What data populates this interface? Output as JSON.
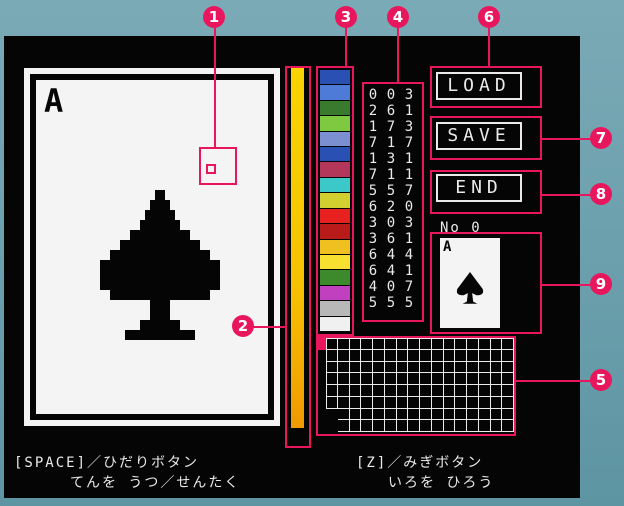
{
  "card": {
    "rank": "A",
    "suit_icon": "spade"
  },
  "buttons": {
    "load": "LOAD",
    "save": "SAVE",
    "end": "END"
  },
  "preview": {
    "label": "No 0",
    "rank": "A"
  },
  "hints": {
    "left_line1": "[SPACE]／ひだりボタン",
    "left_line2": "てんを うつ／せんたく",
    "right_line1": "[Z]／みぎボタン",
    "right_line2": "いろを ひろう"
  },
  "callouts": [
    "1",
    "2",
    "3",
    "4",
    "5",
    "6",
    "7",
    "8",
    "9"
  ],
  "palette": [
    "#2b50b4",
    "#4e7ad8",
    "#3a7a2e",
    "#7fc940",
    "#7c8fd0",
    "#2b50b4",
    "#b3375a",
    "#3cc8c8",
    "#d2d030",
    "#e82020",
    "#b91a1a",
    "#f0c020",
    "#f8e030",
    "#3c8a2c",
    "#c040c0",
    "#b8b8b8",
    "#f0f0f0"
  ],
  "color_codes": [
    [
      "0",
      "0",
      "3"
    ],
    [
      "2",
      "6",
      "1"
    ],
    [
      "1",
      "7",
      "3"
    ],
    [
      "7",
      "1",
      "7"
    ],
    [
      "1",
      "3",
      "1"
    ],
    [
      "7",
      "1",
      "1"
    ],
    [
      "5",
      "5",
      "7"
    ],
    [
      "6",
      "2",
      "0"
    ],
    [
      "3",
      "0",
      "3"
    ],
    [
      "3",
      "6",
      "1"
    ],
    [
      "6",
      "4",
      "4"
    ],
    [
      "6",
      "4",
      "1"
    ],
    [
      "4",
      "0",
      "7"
    ],
    [
      "5",
      "5",
      "5"
    ]
  ],
  "colors": {
    "accent": "#e8175d",
    "screen": "#050505",
    "card": "#f4f4f4",
    "bar": "#f6c200"
  }
}
